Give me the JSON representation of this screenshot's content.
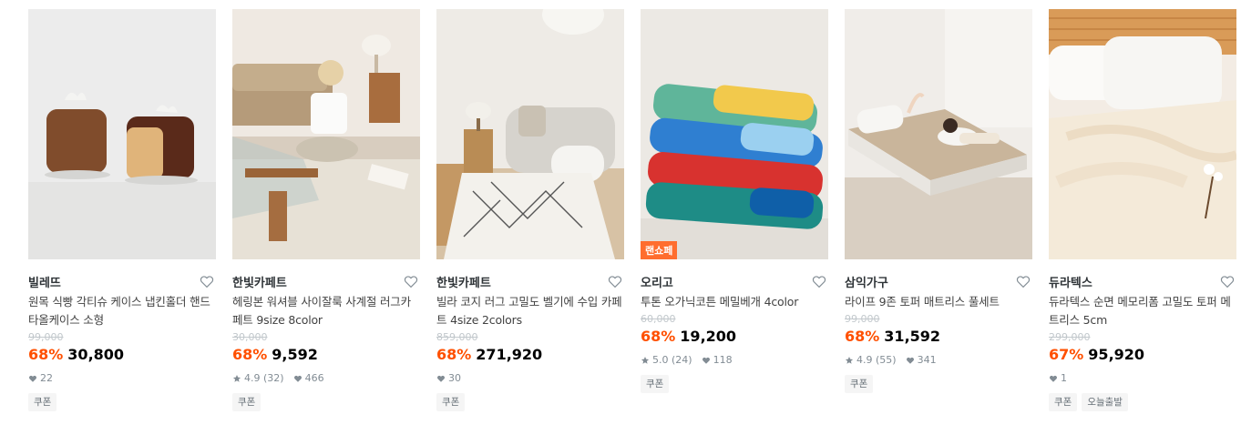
{
  "products": [
    {
      "brand": "빌레뜨",
      "title": "원목 식빵 각티슈 케이스 냅킨홀더 핸드타올케이스 소형",
      "original_price": "99,000",
      "discount": "68%",
      "price": "30,800",
      "rating": "",
      "reviews": "",
      "likes": "22",
      "tags": [
        "쿠폰"
      ],
      "ad_badge": ""
    },
    {
      "brand": "한빛카페트",
      "title": "헤링본 워셔블 사이잘룩 사계절 러그카페트 9size 8color",
      "original_price": "30,000",
      "discount": "68%",
      "price": "9,592",
      "rating": "4.9",
      "reviews": "(32)",
      "likes": "466",
      "tags": [
        "쿠폰"
      ],
      "ad_badge": ""
    },
    {
      "brand": "한빛카페트",
      "title": "빌라 코지 러그 고밀도 벨기에 수입 카페트 4size 2colors",
      "original_price": "859,000",
      "discount": "68%",
      "price": "271,920",
      "rating": "",
      "reviews": "",
      "likes": "30",
      "tags": [
        "쿠폰"
      ],
      "ad_badge": ""
    },
    {
      "brand": "오리고",
      "title": "투톤 오가닉코튼 메밀베개 4color",
      "original_price": "60,000",
      "discount": "68%",
      "price": "19,200",
      "rating": "5.0",
      "reviews": "(24)",
      "likes": "118",
      "tags": [
        "쿠폰"
      ],
      "ad_badge": "랜쇼페"
    },
    {
      "brand": "삼익가구",
      "title": "라이프 9존 토퍼 매트리스 풀세트",
      "original_price": "99,000",
      "discount": "68%",
      "price": "31,592",
      "rating": "4.9",
      "reviews": "(55)",
      "likes": "341",
      "tags": [
        "쿠폰"
      ],
      "ad_badge": ""
    },
    {
      "brand": "듀라텍스",
      "title": "듀라텍스 순면 메모리폼 고밀도 토퍼 메트리스 5cm",
      "original_price": "299,000",
      "discount": "67%",
      "price": "95,920",
      "rating": "",
      "reviews": "",
      "likes": "1",
      "tags": [
        "쿠폰",
        "오늘출발"
      ],
      "ad_badge": ""
    }
  ],
  "icons": {
    "heart": "heart-outline-icon",
    "star": "star-icon",
    "like": "heart-filled-icon"
  },
  "colors": {
    "discount": "#ff5000",
    "ad_badge": "#ff6d2e",
    "muted": "#828c94",
    "tag_bg": "#f5f5f5"
  }
}
